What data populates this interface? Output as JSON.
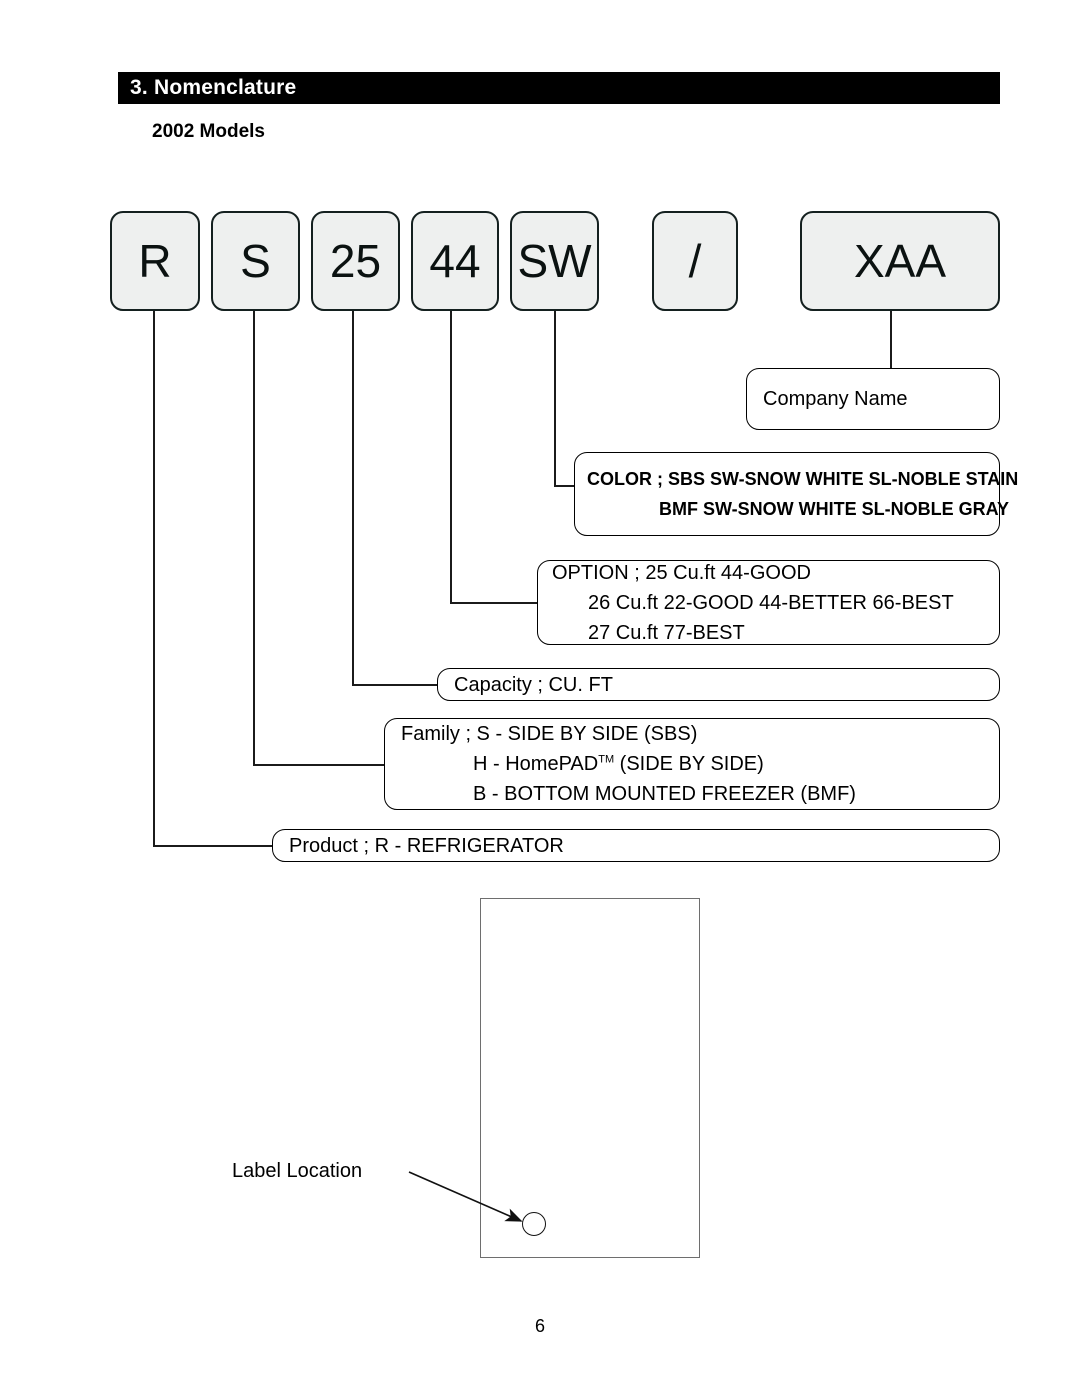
{
  "header": {
    "section_title": "3. Nomenclature",
    "subtitle": "2002 Models"
  },
  "model_code": {
    "segments": [
      {
        "id": "product",
        "value": "R"
      },
      {
        "id": "family",
        "value": "S"
      },
      {
        "id": "capacity",
        "value": "25"
      },
      {
        "id": "option",
        "value": "44"
      },
      {
        "id": "color",
        "value": "SW"
      },
      {
        "id": "separator",
        "value": "/"
      },
      {
        "id": "company",
        "value": "XAA"
      }
    ]
  },
  "descriptions": {
    "company": {
      "lines": [
        "Company Name"
      ]
    },
    "color": {
      "lines": [
        "COLOR ; SBS SW-SNOW WHITE  SL-NOBLE STAIN",
        "BMF SW-SNOW WHITE  SL-NOBLE GRAY"
      ]
    },
    "option": {
      "lines": [
        "OPTION ; 25 Cu.ft 44-GOOD",
        "26 Cu.ft 22-GOOD  44-BETTER  66-BEST",
        "27 Cu.ft 77-BEST"
      ]
    },
    "capacity": {
      "lines": [
        "Capacity ; CU. FT"
      ]
    },
    "family": {
      "lines": [
        "Family ;  S - SIDE BY SIDE (SBS)",
        "H - HomePAD",
        "B - BOTTOM MOUNTED FREEZER (BMF)"
      ],
      "trademark": "TM",
      "family_line2_tail": " (SIDE BY SIDE)"
    },
    "product": {
      "lines": [
        "Product ; R - REFRIGERATOR"
      ]
    }
  },
  "illustration": {
    "label_location": "Label Location"
  },
  "footer": {
    "page_number": "6"
  },
  "colors": {
    "bar_background": "#000000",
    "bar_text": "#ffffff",
    "codebox_fill": "#eef0ef",
    "codebox_border": "#14201f",
    "line": "#1b1b1b",
    "fridge_border": "#6e6e6e"
  }
}
